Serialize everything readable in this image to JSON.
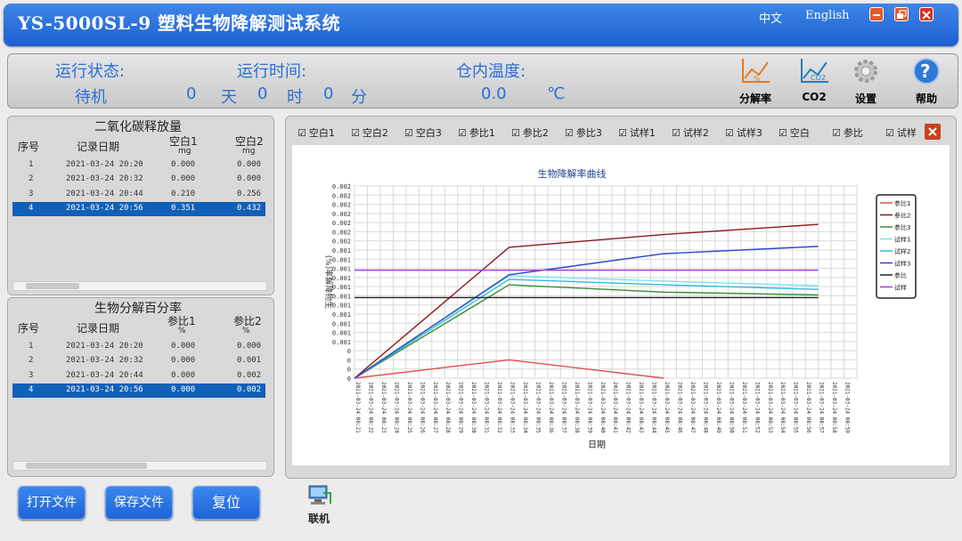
{
  "app": {
    "title": "YS-5000SL-9 塑料生物降解测试系统",
    "lang_zh": "中文",
    "lang_en": "English"
  },
  "status": {
    "run_state_label": "运行状态:",
    "run_state_value": "待机",
    "run_time_label": "运行时间:",
    "days": "0",
    "day_unit": "天",
    "hours": "0",
    "hour_unit": "时",
    "minutes": "0",
    "minute_unit": "分",
    "temp_label": "仓内温度:",
    "temp_value": "0.0",
    "temp_unit": "℃"
  },
  "toolbar": {
    "degradation_label": "分解率",
    "co2_label": "CO2",
    "settings_label": "设置",
    "help_label": "帮助"
  },
  "co2_table": {
    "title": "二氧化碳释放量",
    "headers": {
      "index": "序号",
      "date": "记录日期",
      "c1": "空白1",
      "c1_unit": "mg",
      "c2": "空白2",
      "c2_unit": "mg"
    },
    "rows": [
      {
        "i": "1",
        "date": "2021-03-24 20:20",
        "a": "0.000",
        "b": "0.000"
      },
      {
        "i": "2",
        "date": "2021-03-24 20:32",
        "a": "0.000",
        "b": "0.000"
      },
      {
        "i": "3",
        "date": "2021-03-24 20:44",
        "a": "0.210",
        "b": "0.256"
      },
      {
        "i": "4",
        "date": "2021-03-24 20:56",
        "a": "0.351",
        "b": "0.432"
      }
    ]
  },
  "bio_table": {
    "title": "生物分解百分率",
    "headers": {
      "index": "序号",
      "date": "记录日期",
      "c1": "参比1",
      "c1_unit": "%",
      "c2": "参比2",
      "c2_unit": "%"
    },
    "rows": [
      {
        "i": "1",
        "date": "2021-03-24 20:20",
        "a": "0.000",
        "b": "0.000"
      },
      {
        "i": "2",
        "date": "2021-03-24 20:32",
        "a": "0.000",
        "b": "0.001"
      },
      {
        "i": "3",
        "date": "2021-03-24 20:44",
        "a": "0.000",
        "b": "0.002"
      },
      {
        "i": "4",
        "date": "2021-03-24 20:56",
        "a": "0.000",
        "b": "0.002"
      }
    ]
  },
  "checkboxes": [
    "空白1",
    "空白2",
    "空白3",
    "参比1",
    "参比2",
    "参比3",
    "试样1",
    "试样2",
    "试样3",
    "空白",
    "参比",
    "试样"
  ],
  "buttons": {
    "open": "打开文件",
    "save": "保存文件",
    "reset": "复位",
    "online": "联机"
  },
  "chart_data": {
    "type": "line",
    "title": "生物降解率曲线",
    "xlabel": "日期",
    "ylabel": "(%)率解降物生",
    "y_ticks": [
      "0.002",
      "0.002",
      "0.002",
      "0.002",
      "0.002",
      "0.002",
      "0.002",
      "0.001",
      "0.001",
      "0.001",
      "0.001",
      "0.001",
      "0.001",
      "0.001",
      "0.001",
      "0.001",
      "0.001",
      "0.001",
      "0",
      "0",
      "0",
      "0"
    ],
    "x_ticks": [
      "2021-03-24 08:21",
      "2021-03-24 08:22",
      "2021-03-24 08:23",
      "2021-03-24 08:24",
      "2021-03-24 08:25",
      "2021-03-24 08:26",
      "2021-03-24 08:27",
      "2021-03-24 08:28",
      "2021-03-24 08:29",
      "2021-03-24 08:30",
      "2021-03-24 08:31",
      "2021-03-24 08:32",
      "2021-03-24 08:33",
      "2021-03-24 08:34",
      "2021-03-24 08:35",
      "2021-03-24 08:36",
      "2021-03-24 08:37",
      "2021-03-24 08:38",
      "2021-03-24 08:39",
      "2021-03-24 08:40",
      "2021-03-24 08:41",
      "2021-03-24 08:42",
      "2021-03-24 08:43",
      "2021-03-24 08:44",
      "2021-03-24 08:45",
      "2021-03-24 08:46",
      "2021-03-24 08:47",
      "2021-03-24 08:48",
      "2021-03-24 08:49",
      "2021-03-24 08:50",
      "2021-03-24 08:51",
      "2021-03-24 08:52",
      "2021-03-24 08:53",
      "2021-03-24 08:54",
      "2021-03-24 08:55",
      "2021-03-24 08:56",
      "2021-03-24 08:57",
      "2021-03-24 08:58",
      "2021-03-24 08:59"
    ],
    "x_index_range": [
      0,
      39
    ],
    "ylim": [
      0,
      0.0021
    ],
    "series": [
      {
        "name": "参比1",
        "color": "#e05050",
        "points": [
          [
            0,
            0
          ],
          [
            12,
            0.0002
          ],
          [
            24,
            0
          ]
        ]
      },
      {
        "name": "参比2",
        "color": "#8b1a1a",
        "points": [
          [
            0,
            0
          ],
          [
            12,
            0.00143
          ],
          [
            24,
            0.00157
          ],
          [
            36,
            0.00168
          ]
        ]
      },
      {
        "name": "参比3",
        "color": "#3a8a3a",
        "points": [
          [
            0,
            0
          ],
          [
            12,
            0.00102
          ],
          [
            24,
            0.00094
          ],
          [
            36,
            0.00091
          ]
        ]
      },
      {
        "name": "试样1",
        "color": "#7fe0ee",
        "points": [
          [
            0,
            0
          ],
          [
            12,
            0.00112
          ],
          [
            24,
            0.00106
          ],
          [
            36,
            0.00101
          ]
        ]
      },
      {
        "name": "试样2",
        "color": "#30bcd6",
        "points": [
          [
            0,
            0
          ],
          [
            12,
            0.00108
          ],
          [
            24,
            0.00102
          ],
          [
            36,
            0.00097
          ]
        ]
      },
      {
        "name": "试样3",
        "color": "#2e45c7",
        "points": [
          [
            0,
            0
          ],
          [
            12,
            0.00113
          ],
          [
            24,
            0.00136
          ],
          [
            36,
            0.00144
          ]
        ]
      },
      {
        "name": "参比",
        "color": "#222222",
        "points": [
          [
            0,
            0.00088
          ],
          [
            36,
            0.00088
          ]
        ]
      },
      {
        "name": "试样",
        "color": "#a23fd8",
        "points": [
          [
            0,
            0.00118
          ],
          [
            36,
            0.00118
          ]
        ]
      }
    ],
    "grid": true,
    "legend": "right"
  }
}
